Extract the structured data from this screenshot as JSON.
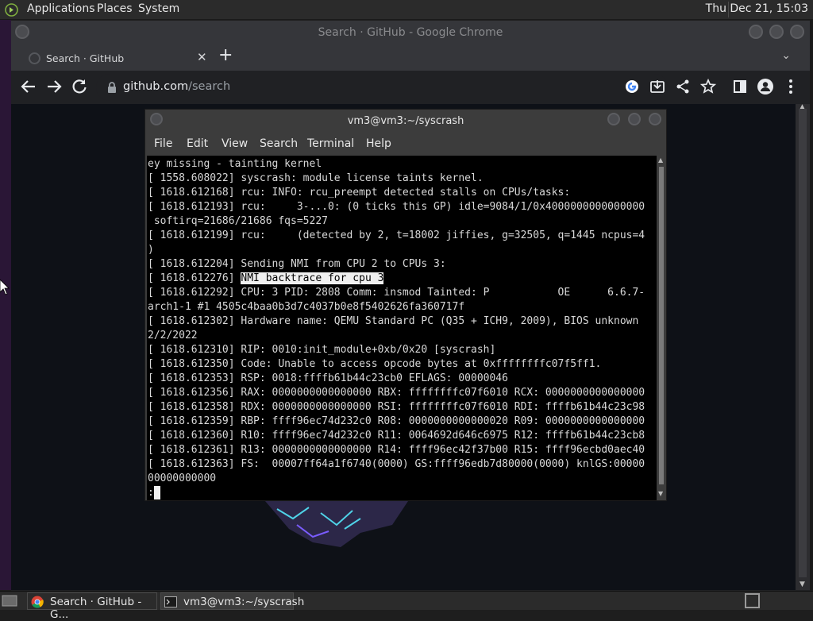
{
  "top_panel": {
    "menus": [
      "Applications",
      "Places",
      "System"
    ],
    "clock": "Thu Dec 21, 15:03"
  },
  "chrome": {
    "window_title": "Search · GitHub - Google Chrome",
    "tab_title": "Search · GitHub",
    "url_host": "github.com",
    "url_path": "/search"
  },
  "terminal": {
    "title": "vm3@vm3:~/syscrash",
    "menus": [
      "File",
      "Edit",
      "View",
      "Search",
      "Terminal",
      "Help"
    ],
    "lines_before": [
      "ey missing - tainting kernel",
      "[ 1558.608022] syscrash: module license taints kernel.",
      "[ 1618.612168] rcu: INFO: rcu_preempt detected stalls on CPUs/tasks:",
      "[ 1618.612193] rcu:     3-...0: (0 ticks this GP) idle=9084/1/0x4000000000000000",
      " softirq=21686/21686 fqs=5227",
      "[ 1618.612199] rcu:     (detected by 2, t=18002 jiffies, g=32505, q=1445 ncpus=4",
      ")",
      "[ 1618.612204] Sending NMI from CPU 2 to CPUs 3:"
    ],
    "highlight_prefix": "[ 1618.612276] ",
    "highlight_text": "NMI backtrace for cpu 3",
    "lines_after": [
      "[ 1618.612292] CPU: 3 PID: 2808 Comm: insmod Tainted: P           OE      6.6.7-",
      "arch1-1 #1 4505c4baa0b3d7c4037b0e8f5402626fa360717f",
      "[ 1618.612302] Hardware name: QEMU Standard PC (Q35 + ICH9, 2009), BIOS unknown",
      "2/2/2022",
      "[ 1618.612310] RIP: 0010:init_module+0xb/0x20 [syscrash]",
      "[ 1618.612350] Code: Unable to access opcode bytes at 0xffffffffc07f5ff1.",
      "[ 1618.612353] RSP: 0018:ffffb61b44c23cb0 EFLAGS: 00000046",
      "[ 1618.612356] RAX: 0000000000000000 RBX: ffffffffc07f6010 RCX: 0000000000000000",
      "[ 1618.612358] RDX: 0000000000000000 RSI: ffffffffc07f6010 RDI: ffffb61b44c23c98",
      "[ 1618.612359] RBP: ffff96ec74d232c0 R08: 0000000000000020 R09: 0000000000000000",
      "[ 1618.612360] R10: ffff96ec74d232c0 R11: 0064692d646c6975 R12: ffffb61b44c23cb8",
      "[ 1618.612361] R13: 0000000000000000 R14: ffff96ec42f37b00 R15: ffff96ecbd0aec40",
      "[ 1618.612363] FS:  00007ff64a1f6740(0000) GS:ffff96edb7d80000(0000) knlGS:00000",
      "00000000000"
    ],
    "prompt": ":"
  },
  "taskbar": {
    "tasks": [
      "Search · GitHub - G...",
      "vm3@vm3:~/syscrash"
    ]
  },
  "colors": {
    "chrome_frame": "#35363a",
    "terminal_bg": "#000000",
    "terminal_fg": "#d8d8d8"
  }
}
